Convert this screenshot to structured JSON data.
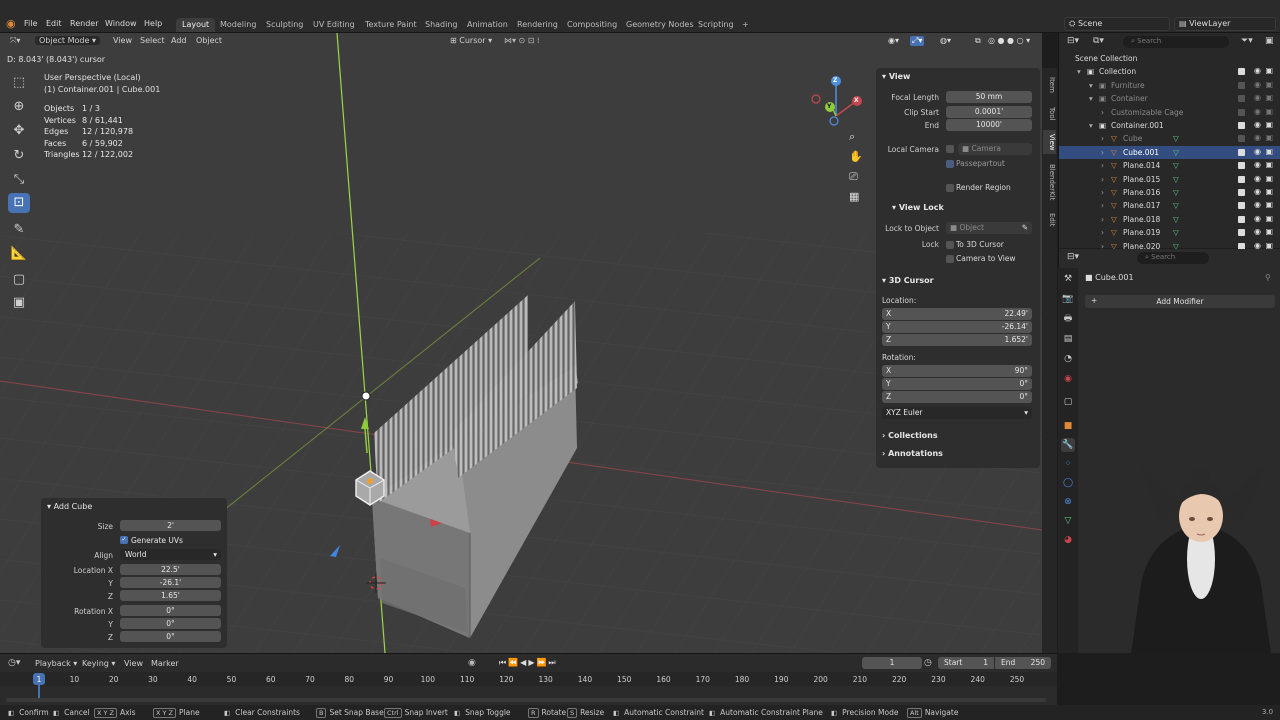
{
  "menubar": {
    "items": [
      "File",
      "Edit",
      "Render",
      "Window",
      "Help"
    ],
    "workspaces": [
      "Layout",
      "Modeling",
      "Sculpting",
      "UV Editing",
      "Texture Paint",
      "Shading",
      "Animation",
      "Rendering",
      "Compositing",
      "Geometry Nodes",
      "Scripting"
    ],
    "active_workspace": "Layout",
    "add_tab": "+",
    "scene": "Scene",
    "view_layer": "ViewLayer"
  },
  "viewport_header": {
    "mode": "Object Mode",
    "menus": [
      "View",
      "Select",
      "Add",
      "Object"
    ],
    "orientation": "Cursor"
  },
  "viewport": {
    "cursor_readout": "D: 8.043' (8.043') cursor",
    "perspective": "User Perspective (Local)",
    "context": "(1) Container.001 | Cube.001",
    "stats": [
      {
        "label": "Objects",
        "value": "1 / 3"
      },
      {
        "label": "Vertices",
        "value": "8 / 61,441"
      },
      {
        "label": "Edges",
        "value": "12 / 120,978"
      },
      {
        "label": "Faces",
        "value": "6 / 59,902"
      },
      {
        "label": "Triangles",
        "value": "12 / 122,002"
      }
    ],
    "gizmo": {
      "x": "X",
      "y": "Y",
      "z": "Z"
    }
  },
  "npanel": {
    "view_header": "View",
    "focal_length_label": "Focal Length",
    "focal_length": "50 mm",
    "clip_start_label": "Clip Start",
    "clip_start": "0.0001'",
    "end_label": "End",
    "clip_end": "10000'",
    "local_camera_label": "Local Camera",
    "camera_placeholder": "Camera",
    "passepartout": "Passepartout",
    "render_region": "Render Region",
    "view_lock_header": "View Lock",
    "lock_to_object_label": "Lock to Object",
    "object_placeholder": "Object",
    "lock_label": "Lock",
    "to_3d_cursor": "To 3D Cursor",
    "camera_to_view": "Camera to View",
    "cursor_header": "3D Cursor",
    "location_label": "Location:",
    "loc": [
      {
        "axis": "X",
        "value": "22.49'"
      },
      {
        "axis": "Y",
        "value": "-26.14'"
      },
      {
        "axis": "Z",
        "value": "1.652'"
      }
    ],
    "rotation_label": "Rotation:",
    "rot": [
      {
        "axis": "X",
        "value": "90°"
      },
      {
        "axis": "Y",
        "value": "0°"
      },
      {
        "axis": "Z",
        "value": "0°"
      }
    ],
    "rotation_mode": "XYZ Euler",
    "collections": "Collections",
    "annotations": "Annotations",
    "tabs": [
      "Item",
      "Tool",
      "View",
      "BlenderKit",
      "Edit"
    ],
    "active_tab": "View"
  },
  "operator_panel": {
    "title": "Add Cube",
    "size_label": "Size",
    "size": "2'",
    "generate_uvs": "Generate UVs",
    "align_label": "Align",
    "align": "World",
    "location_label": "Location X",
    "loc_x": "22.5'",
    "y_label": "Y",
    "loc_y": "-26.1'",
    "z_label": "Z",
    "loc_z": "1.65'",
    "rotation_label": "Rotation X",
    "rot_x": "0°",
    "rot_y": "0°",
    "rot_z": "0°"
  },
  "outliner": {
    "search_placeholder": "Search",
    "rows": [
      {
        "name": "Scene Collection",
        "indent": 0,
        "dim": false,
        "sel": false,
        "icon": "",
        "eye": false
      },
      {
        "name": "Collection",
        "indent": 1,
        "dim": false,
        "sel": false,
        "icon": "▣",
        "eye": true
      },
      {
        "name": "Furniture",
        "indent": 2,
        "dim": true,
        "sel": false,
        "icon": "▣",
        "eye": true
      },
      {
        "name": "Container",
        "indent": 2,
        "dim": true,
        "sel": false,
        "icon": "▣",
        "eye": true
      },
      {
        "name": "Customizable Cage",
        "indent": 3,
        "dim": true,
        "sel": false,
        "icon": "",
        "eye": true
      },
      {
        "name": "Container.001",
        "indent": 2,
        "dim": false,
        "sel": false,
        "icon": "▣",
        "eye": true
      },
      {
        "name": "Cube",
        "indent": 3,
        "dim": true,
        "sel": false,
        "icon": "▽",
        "eye": true
      },
      {
        "name": "Cube.001",
        "indent": 3,
        "dim": false,
        "sel": true,
        "icon": "▽",
        "eye": true
      },
      {
        "name": "Plane.014",
        "indent": 3,
        "dim": false,
        "sel": false,
        "icon": "▽",
        "eye": true
      },
      {
        "name": "Plane.015",
        "indent": 3,
        "dim": false,
        "sel": false,
        "icon": "▽",
        "eye": true
      },
      {
        "name": "Plane.016",
        "indent": 3,
        "dim": false,
        "sel": false,
        "icon": "▽",
        "eye": true
      },
      {
        "name": "Plane.017",
        "indent": 3,
        "dim": false,
        "sel": false,
        "icon": "▽",
        "eye": true
      },
      {
        "name": "Plane.018",
        "indent": 3,
        "dim": false,
        "sel": false,
        "icon": "▽",
        "eye": true
      },
      {
        "name": "Plane.019",
        "indent": 3,
        "dim": false,
        "sel": false,
        "icon": "▽",
        "eye": true
      },
      {
        "name": "Plane.020",
        "indent": 3,
        "dim": false,
        "sel": false,
        "icon": "▽",
        "eye": true
      }
    ]
  },
  "properties": {
    "search_placeholder": "Search",
    "object_name": "Cube.001",
    "add_modifier": "Add Modifier"
  },
  "timeline": {
    "menus": [
      "Playback",
      "Keying",
      "View",
      "Marker"
    ],
    "current_frame": "1",
    "start_label": "Start",
    "start": "1",
    "end_label": "End",
    "end": "250",
    "ticks": [
      "1",
      "10",
      "20",
      "30",
      "40",
      "50",
      "60",
      "70",
      "80",
      "90",
      "100",
      "110",
      "120",
      "130",
      "140",
      "150",
      "160",
      "170",
      "180",
      "190",
      "200",
      "210",
      "220",
      "230",
      "240",
      "250"
    ]
  },
  "statusbar": {
    "items": [
      "Confirm",
      "Cancel",
      "Axis",
      "Plane",
      "Clear Constraints",
      "Set Snap Base",
      "Snap Invert",
      "Snap Toggle",
      "Rotate",
      "Resize",
      "Automatic Constraint",
      "Automatic Constraint Plane",
      "Precision Mode",
      "Navigate"
    ],
    "keys": [
      "",
      "",
      "X Y Z",
      "X Y Z",
      "",
      "B",
      "Ctrl",
      "",
      "R",
      "S",
      "",
      "",
      "",
      "Alt"
    ],
    "version": "3.0"
  },
  "colors": {
    "accent": "#4772b3",
    "x_axis": "#c8454f",
    "y_axis": "#8fcc3a",
    "z_axis": "#4f8fe0",
    "viewport_bg": "#3d3d3d",
    "selected_row": "#334d80"
  }
}
